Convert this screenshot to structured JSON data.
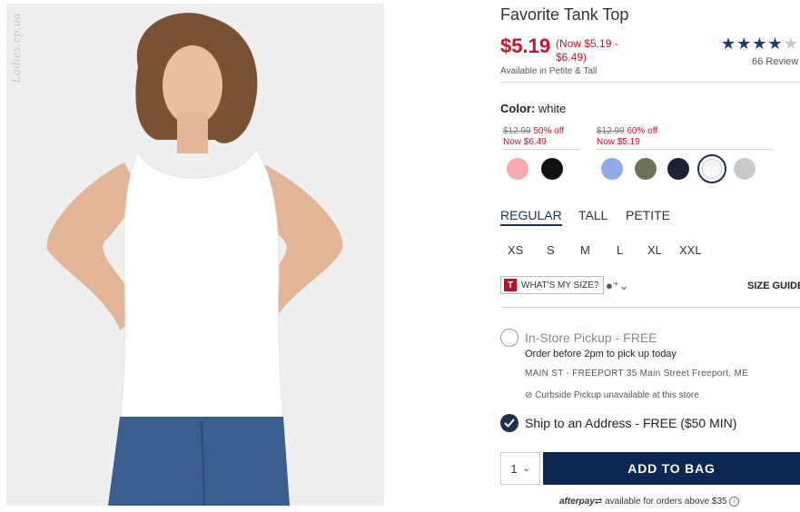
{
  "photo": {
    "watermark": "Ladies.ep.ua"
  },
  "product": {
    "title": "Favorite Tank Top",
    "price": "$5.19",
    "price_range": "(Now $5.19 - $6.49)",
    "availability": "Available in Petite & Tall",
    "rating_stars": 4,
    "review_count": "66 Review"
  },
  "color": {
    "label": "Color:",
    "selected": "white",
    "groups": [
      {
        "original": "$12.99",
        "discount": "50% off",
        "now": "Now $6.49",
        "swatches": [
          {
            "name": "pink",
            "hex": "#f3a9ad"
          },
          {
            "name": "black",
            "hex": "#111111"
          }
        ]
      },
      {
        "original": "$12.99",
        "discount": "60% off",
        "now": "Now $5.19",
        "swatches": [
          {
            "name": "periwinkle",
            "hex": "#8ea8e8"
          },
          {
            "name": "olive",
            "hex": "#6f7256"
          },
          {
            "name": "navy",
            "hex": "#1c2236"
          },
          {
            "name": "white",
            "hex": "#f7f7f7",
            "selected": true
          },
          {
            "name": "heather grey",
            "hex": "#c9c9c9"
          }
        ]
      }
    ]
  },
  "fit_tabs": [
    {
      "label": "REGULAR",
      "active": true
    },
    {
      "label": "TALL"
    },
    {
      "label": "PETITE"
    }
  ],
  "sizes": [
    "XS",
    "S",
    "M",
    "L",
    "XL",
    "XXL"
  ],
  "size_tools": {
    "whats_my_size": "WHAT'S MY SIZE?",
    "badge": "T",
    "size_guide": "SIZE GUIDE"
  },
  "fulfillment": {
    "pickup_title": "In-Store Pickup - FREE",
    "pickup_note": "Order before 2pm to pick up today",
    "store": "MAIN ST - FREEPORT  35 Main Street  Freeport, ME",
    "curbside": "Curbside Pickup unavailable at this store",
    "ship_label": "Ship to an Address - FREE ($50 MIN)"
  },
  "cart": {
    "quantity": "1",
    "add_label": "ADD TO BAG"
  },
  "afterpay": {
    "brand": "afterpay",
    "text": "available for orders above $35"
  }
}
